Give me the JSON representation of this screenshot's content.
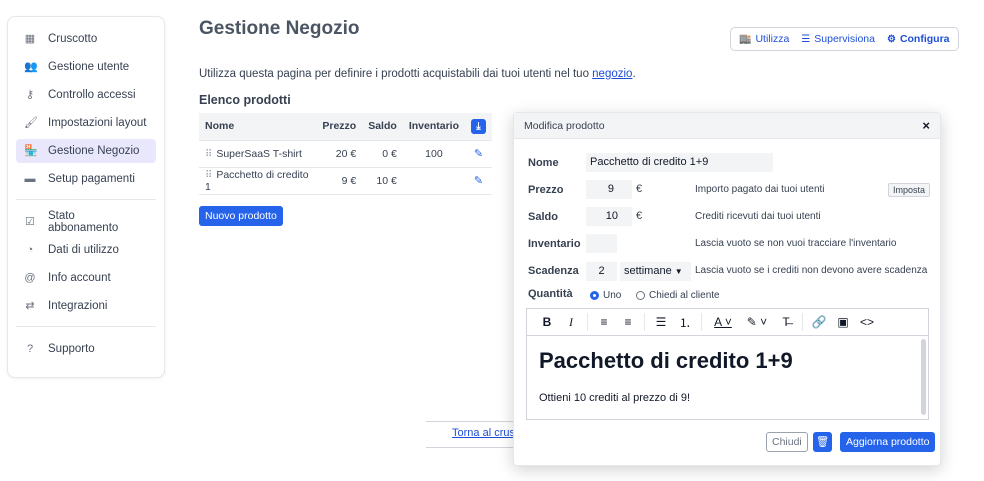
{
  "sidebar": {
    "items": [
      {
        "label": "Cruscotto",
        "icon": "dashboard-icon",
        "active": false
      },
      {
        "label": "Gestione utente",
        "icon": "users-icon",
        "active": false
      },
      {
        "label": "Controllo accessi",
        "icon": "key-icon",
        "active": false
      },
      {
        "label": "Impostazioni layout",
        "icon": "brush-icon",
        "active": false
      },
      {
        "label": "Gestione Negozio",
        "icon": "store-icon",
        "active": true
      },
      {
        "label": "Setup pagamenti",
        "icon": "credit-card-icon",
        "active": false
      }
    ],
    "items2": [
      {
        "label": "Stato abbonamento",
        "icon": "check-square-icon"
      },
      {
        "label": "Dati di utilizzo",
        "icon": "pie-chart-icon"
      },
      {
        "label": "Info account",
        "icon": "at-icon"
      },
      {
        "label": "Integrazioni",
        "icon": "arrows-icon"
      }
    ],
    "items3": [
      {
        "label": "Supporto",
        "icon": "help-icon"
      }
    ]
  },
  "header": {
    "title": "Gestione Negozio",
    "buttons": {
      "utilizza": "Utilizza",
      "supervisiona": "Supervisiona",
      "configura": "Configura"
    }
  },
  "intro": {
    "text": "Utilizza questa pagina per definire i prodotti acquistabili dai tuoi utenti nel tuo ",
    "link": "negozio",
    "end": "."
  },
  "products": {
    "title": "Elenco prodotti",
    "columns": {
      "nome": "Nome",
      "prezzo": "Prezzo",
      "saldo": "Saldo",
      "inventario": "Inventario"
    },
    "rows": [
      {
        "nome": "SuperSaaS T-shirt",
        "prezzo": "20 €",
        "saldo": "0 €",
        "inventario": "100"
      },
      {
        "nome": "Pacchetto di credito 1",
        "prezzo": "9 €",
        "saldo": "10 €",
        "inventario": ""
      }
    ],
    "new_button": "Nuovo prodotto"
  },
  "backlink": "Torna al cruscotto",
  "modal": {
    "title": "Modifica prodotto",
    "close": "×",
    "labels": {
      "nome": "Nome",
      "prezzo": "Prezzo",
      "saldo": "Saldo",
      "inventario": "Inventario",
      "scadenza": "Scadenza",
      "quantita": "Quantità"
    },
    "values": {
      "nome": "Pacchetto di credito 1+9",
      "prezzo": "9",
      "saldo": "10",
      "inventario": "",
      "scadenza": "2",
      "scadenza_unit": "settimane"
    },
    "currency": "€",
    "hints": {
      "prezzo": "Importo pagato dai tuoi utenti",
      "saldo": "Crediti ricevuti dai tuoi utenti",
      "inventario": "Lascia vuoto se non vuoi tracciare l'inventario",
      "scadenza": "Lascia vuoto se i crediti non devono avere scadenza"
    },
    "imposta": "Imposta",
    "quantity_options": {
      "uno": "Uno",
      "chiedi": "Chiedi al cliente",
      "selected": "uno"
    },
    "editor": {
      "heading": "Pacchetto di credito 1+9",
      "paragraph": "Ottieni 10 crediti al prezzo di 9!"
    },
    "buttons": {
      "chiudi": "Chiudi",
      "aggiorna": "Aggiorna prodotto"
    }
  }
}
